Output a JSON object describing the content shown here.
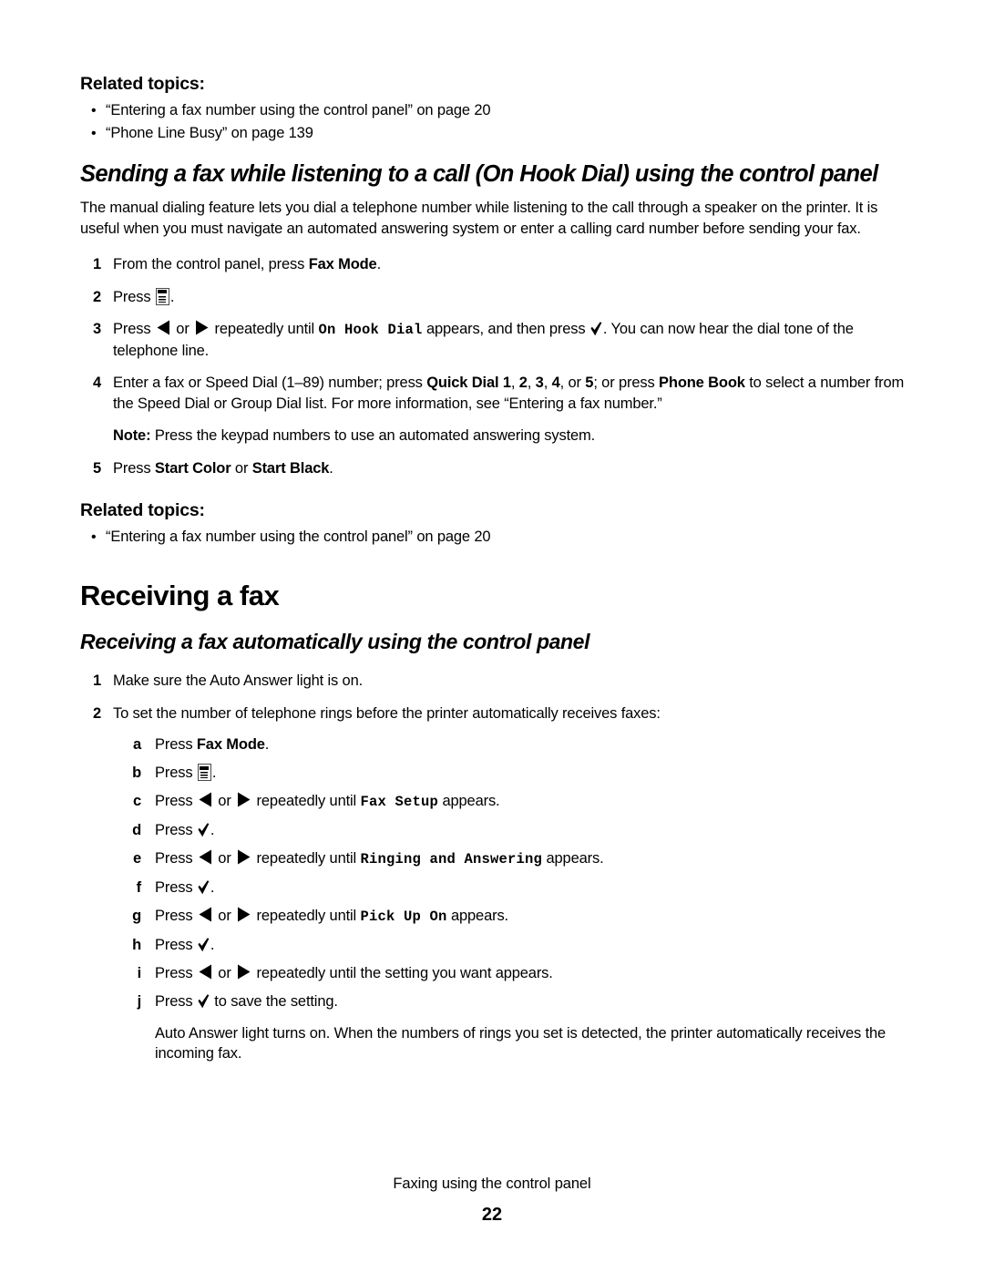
{
  "document": {
    "footer_title": "Faxing using the control panel",
    "page_number": "22"
  },
  "section_related_top": {
    "heading": "Related topics:",
    "bullets": [
      "“Entering a fax number using the control panel” on page 20",
      "“Phone Line Busy” on page 139"
    ]
  },
  "section_on_hook_dial": {
    "heading": "Sending a fax while listening to a call (On Hook Dial) using the control panel",
    "intro": "The manual dialing feature lets you dial a telephone number while listening to the call through a speaker on the printer. It is useful when you must navigate an automated answering system or enter a calling card number before sending your fax.",
    "steps": {
      "s1": {
        "num": "1",
        "pre": "From the control panel, press ",
        "bold": "Fax Mode",
        "post": "."
      },
      "s2": {
        "num": "2",
        "pre": "Press ",
        "post": "."
      },
      "s3": {
        "num": "3",
        "a": "Press ",
        "b": " or ",
        "c": " repeatedly until ",
        "lcd": "On Hook Dial",
        "d": " appears, and then press ",
        "e": ". You can now hear the dial tone of the telephone line."
      },
      "s4": {
        "num": "4",
        "a": "Enter a fax or Speed Dial (1–89) number; press ",
        "bold1": "Quick Dial 1",
        "b": ", ",
        "bold2": "2",
        "c": ", ",
        "bold3": "3",
        "d": ", ",
        "bold4": "4",
        "e": ", or ",
        "bold5": "5",
        "f": "; or press ",
        "bold6": "Phone Book",
        "g": " to select a number from the Speed Dial or Group Dial list. For more information, see “Entering a fax number.”",
        "note_label": "Note:",
        "note_text": " Press the keypad numbers to use an automated answering system."
      },
      "s5": {
        "num": "5",
        "pre": "Press ",
        "bold1": "Start Color",
        "mid": " or ",
        "bold2": "Start Black",
        "post": "."
      }
    }
  },
  "section_related_mid": {
    "heading": "Related topics:",
    "bullets": [
      "“Entering a fax number using the control panel” on page 20"
    ]
  },
  "chapter": {
    "title": "Receiving a fax"
  },
  "section_receive_auto": {
    "heading": "Receiving a fax automatically using the control panel",
    "steps": {
      "s1": {
        "num": "1",
        "text": "Make sure the Auto Answer light is on."
      },
      "s2": {
        "num": "2",
        "text": "To set the number of telephone rings before the printer automatically receives faxes:",
        "substeps": {
          "a": {
            "ltr": "a",
            "pre": "Press ",
            "bold": "Fax Mode",
            "post": "."
          },
          "b": {
            "ltr": "b",
            "pre": "Press ",
            "post": "."
          },
          "c": {
            "ltr": "c",
            "a": "Press ",
            "b": " or ",
            "c": " repeatedly until ",
            "lcd": "Fax Setup",
            "d": " appears."
          },
          "d": {
            "ltr": "d",
            "pre": "Press ",
            "post": "."
          },
          "e": {
            "ltr": "e",
            "a": "Press ",
            "b": " or ",
            "c": " repeatedly until ",
            "lcd": "Ringing and Answering",
            "d": " appears."
          },
          "f": {
            "ltr": "f",
            "pre": "Press ",
            "post": "."
          },
          "g": {
            "ltr": "g",
            "a": "Press ",
            "b": " or ",
            "c": " repeatedly until ",
            "lcd": "Pick Up On",
            "d": " appears."
          },
          "h": {
            "ltr": "h",
            "pre": "Press ",
            "post": "."
          },
          "i": {
            "ltr": "i",
            "a": "Press ",
            "b": " or ",
            "c": " repeatedly until the setting you want appears."
          },
          "j": {
            "ltr": "j",
            "pre": "Press ",
            "post": " to save the setting."
          }
        },
        "tail": "Auto Answer light turns on. When the numbers of rings you set is detected, the printer automatically receives the incoming fax."
      }
    }
  },
  "icons": {
    "menu": "menu-icon",
    "left_arrow": "left-arrow-icon",
    "right_arrow": "right-arrow-icon",
    "check": "check-icon",
    "bullet": "•"
  },
  "colors": {
    "text": "#000000",
    "page_background": "#ffffff",
    "icon_border": "#4a4a4a"
  }
}
